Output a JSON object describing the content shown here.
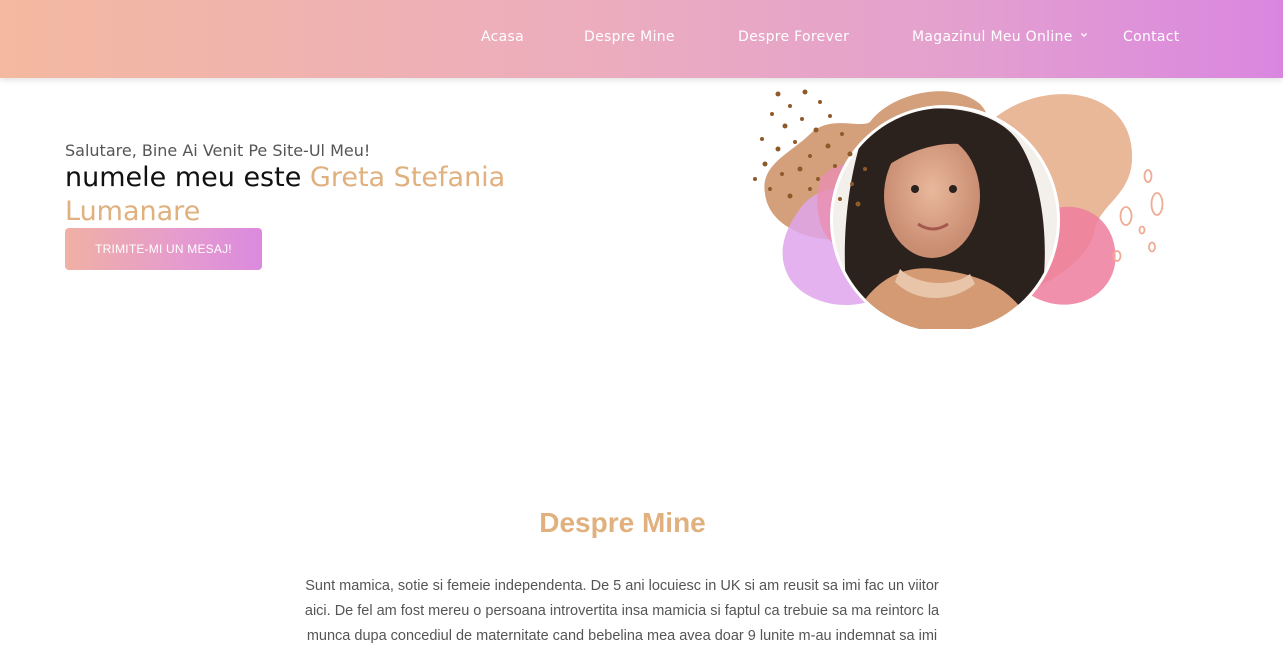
{
  "nav": {
    "items": [
      {
        "label": "Acasa"
      },
      {
        "label": "Despre Mine"
      },
      {
        "label": "Despre Forever"
      },
      {
        "label": "Magazinul Meu Online",
        "icon": "chevron-down-icon"
      },
      {
        "label": "Contact"
      }
    ]
  },
  "hero": {
    "greeting": "Salutare, Bine Ai Venit Pe Site-Ul Meu!",
    "name_prefix": "numele meu este",
    "name": "Greta Stefania Lumanare",
    "cta_label": "TRIMITE-MI UN MESAJ!"
  },
  "about": {
    "title": "Despre Mine",
    "text": "Sunt mamica, sotie si femeie independenta. De 5 ani locuiesc in UK si am reusit sa imi fac un viitor aici. De fel am fost mereu o persoana introvertita insa mamicia si faptul ca trebuie sa ma reintorc la munca dupa concediul de maternitate cand bebelina mea avea doar 9 lunite m-au indemnat sa imi"
  },
  "colors": {
    "accent": "#e0b07e",
    "header_gradient_start": "#f4b9a0",
    "header_gradient_end": "#da86e0"
  }
}
